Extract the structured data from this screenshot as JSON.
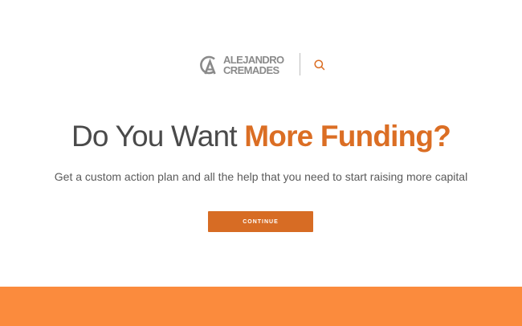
{
  "colors": {
    "accent": "#db6e24",
    "button": "#d76c24",
    "footer_band": "#fb8b3d",
    "logo_gray": "#8a8a8a"
  },
  "header": {
    "logo": {
      "line1": "ALEJANDRO",
      "line2": "CREMADES",
      "icon": "ac-monogram-icon"
    },
    "search": {
      "icon": "search-icon"
    }
  },
  "hero": {
    "headline_plain": "Do You Want",
    "headline_accent": "More Funding?",
    "subheadline": "Get a custom action plan and all the help that you need to start raising more capital",
    "cta_label": "CONTINUE"
  }
}
